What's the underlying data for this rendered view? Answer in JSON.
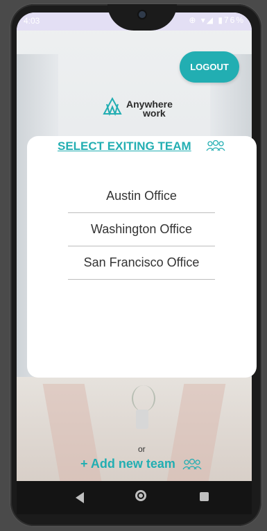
{
  "status_bar": {
    "time": "4:03",
    "icons_text": "⊕ ▾◢ ▮76%"
  },
  "header": {
    "logout_label": "LOGOUT"
  },
  "logo": {
    "line1": "Anywhere",
    "line2": "work"
  },
  "team_select": {
    "title": "SELECT EXITING TEAM",
    "teams": [
      "Austin Office",
      "Washington Office",
      "San Francisco Office"
    ]
  },
  "footer": {
    "or_label": "or",
    "add_team_label": "+ Add new team"
  },
  "colors": {
    "accent": "#22aeb2",
    "text": "#333333"
  },
  "icons": {
    "team": "team-icon",
    "back": "back-icon",
    "home": "home-icon",
    "recent": "recent-apps-icon"
  }
}
